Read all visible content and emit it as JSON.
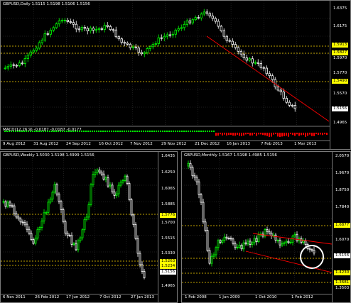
{
  "colors": {
    "bull": "#00ff00",
    "bear": "#ffffff",
    "level": "#ffd800",
    "trend": "#ff0000",
    "tag_bg": "#ffff00",
    "price_bg": "#ffffff",
    "grid": "#777777"
  },
  "daily": {
    "title": "GBPUSD,Daily 1.5115 1.5198 1.5106 1.5156",
    "price_labels": [
      "1.6375",
      "1.6175",
      "1.5970",
      "1.5770",
      "1.5570",
      "1.5370",
      "1.5170",
      "1.4965"
    ],
    "level_tags": [
      "1.5913",
      "1.5827",
      "1.5490"
    ],
    "current_price": "1.5156",
    "macd_label": "MACD(12,26,9) -0.0187 -0.0187 -0.0177",
    "time_labels": [
      "9 Aug 2012",
      "31 Aug 2012",
      "24 Sep 2012",
      "16 Oct 2012",
      "7 Nov 2012",
      "29 Nov 2012",
      "21 Dec 2012",
      "16 Jan 2013",
      "7 Feb 2013",
      "1 Mar 2013"
    ]
  },
  "weekly": {
    "title": "GBPUSD,Weekly 1.5030 1.5198 1.4999 1.5156",
    "price_labels": [
      "1.6435",
      "1.6250",
      "1.6065",
      "1.5885",
      "1.5700",
      "1.5515",
      "1.5330",
      "1.4965"
    ],
    "level_tags": [
      "1.5776",
      "1.5263",
      "1.5234"
    ],
    "current_price": "1.5156",
    "time_labels": [
      "6 Nov 2011",
      "26 Feb 2012",
      "17 Jun 2012",
      "7 Oct 2012",
      "27 Jan 2013"
    ]
  },
  "monthly": {
    "title": "GBPUSD,Monthly 1.5167 1.5198 1.4985 1.5156",
    "price_labels": [
      "2.0570",
      "1.9670",
      "1.8750",
      "1.7840",
      "1.6070",
      "1.5156",
      "1.4230",
      "1.3681",
      "1.3503"
    ],
    "level_tags": [
      "1.6877",
      "1.4230",
      "1.3681"
    ],
    "current_price": "1.5156",
    "time_labels": [
      "1 Feb 2008",
      "1 Jun 2009",
      "1 Oct 2010",
      "1 Feb 2012"
    ]
  }
}
